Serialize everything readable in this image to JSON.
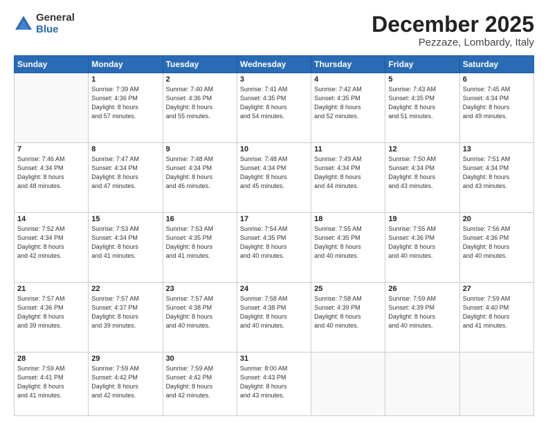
{
  "logo": {
    "general": "General",
    "blue": "Blue"
  },
  "header": {
    "month": "December 2025",
    "location": "Pezzaze, Lombardy, Italy"
  },
  "days_header": [
    "Sunday",
    "Monday",
    "Tuesday",
    "Wednesday",
    "Thursday",
    "Friday",
    "Saturday"
  ],
  "weeks": [
    [
      {
        "day": "",
        "info": ""
      },
      {
        "day": "1",
        "info": "Sunrise: 7:39 AM\nSunset: 4:36 PM\nDaylight: 8 hours\nand 57 minutes."
      },
      {
        "day": "2",
        "info": "Sunrise: 7:40 AM\nSunset: 4:36 PM\nDaylight: 8 hours\nand 55 minutes."
      },
      {
        "day": "3",
        "info": "Sunrise: 7:41 AM\nSunset: 4:35 PM\nDaylight: 8 hours\nand 54 minutes."
      },
      {
        "day": "4",
        "info": "Sunrise: 7:42 AM\nSunset: 4:35 PM\nDaylight: 8 hours\nand 52 minutes."
      },
      {
        "day": "5",
        "info": "Sunrise: 7:43 AM\nSunset: 4:35 PM\nDaylight: 8 hours\nand 51 minutes."
      },
      {
        "day": "6",
        "info": "Sunrise: 7:45 AM\nSunset: 4:34 PM\nDaylight: 8 hours\nand 49 minutes."
      }
    ],
    [
      {
        "day": "7",
        "info": "Sunrise: 7:46 AM\nSunset: 4:34 PM\nDaylight: 8 hours\nand 48 minutes."
      },
      {
        "day": "8",
        "info": "Sunrise: 7:47 AM\nSunset: 4:34 PM\nDaylight: 8 hours\nand 47 minutes."
      },
      {
        "day": "9",
        "info": "Sunrise: 7:48 AM\nSunset: 4:34 PM\nDaylight: 8 hours\nand 46 minutes."
      },
      {
        "day": "10",
        "info": "Sunrise: 7:48 AM\nSunset: 4:34 PM\nDaylight: 8 hours\nand 45 minutes."
      },
      {
        "day": "11",
        "info": "Sunrise: 7:49 AM\nSunset: 4:34 PM\nDaylight: 8 hours\nand 44 minutes."
      },
      {
        "day": "12",
        "info": "Sunrise: 7:50 AM\nSunset: 4:34 PM\nDaylight: 8 hours\nand 43 minutes."
      },
      {
        "day": "13",
        "info": "Sunrise: 7:51 AM\nSunset: 4:34 PM\nDaylight: 8 hours\nand 43 minutes."
      }
    ],
    [
      {
        "day": "14",
        "info": "Sunrise: 7:52 AM\nSunset: 4:34 PM\nDaylight: 8 hours\nand 42 minutes."
      },
      {
        "day": "15",
        "info": "Sunrise: 7:53 AM\nSunset: 4:34 PM\nDaylight: 8 hours\nand 41 minutes."
      },
      {
        "day": "16",
        "info": "Sunrise: 7:53 AM\nSunset: 4:35 PM\nDaylight: 8 hours\nand 41 minutes."
      },
      {
        "day": "17",
        "info": "Sunrise: 7:54 AM\nSunset: 4:35 PM\nDaylight: 8 hours\nand 40 minutes."
      },
      {
        "day": "18",
        "info": "Sunrise: 7:55 AM\nSunset: 4:35 PM\nDaylight: 8 hours\nand 40 minutes."
      },
      {
        "day": "19",
        "info": "Sunrise: 7:55 AM\nSunset: 4:36 PM\nDaylight: 8 hours\nand 40 minutes."
      },
      {
        "day": "20",
        "info": "Sunrise: 7:56 AM\nSunset: 4:36 PM\nDaylight: 8 hours\nand 40 minutes."
      }
    ],
    [
      {
        "day": "21",
        "info": "Sunrise: 7:57 AM\nSunset: 4:36 PM\nDaylight: 8 hours\nand 39 minutes."
      },
      {
        "day": "22",
        "info": "Sunrise: 7:57 AM\nSunset: 4:37 PM\nDaylight: 8 hours\nand 39 minutes."
      },
      {
        "day": "23",
        "info": "Sunrise: 7:57 AM\nSunset: 4:38 PM\nDaylight: 8 hours\nand 40 minutes."
      },
      {
        "day": "24",
        "info": "Sunrise: 7:58 AM\nSunset: 4:38 PM\nDaylight: 8 hours\nand 40 minutes."
      },
      {
        "day": "25",
        "info": "Sunrise: 7:58 AM\nSunset: 4:39 PM\nDaylight: 8 hours\nand 40 minutes."
      },
      {
        "day": "26",
        "info": "Sunrise: 7:59 AM\nSunset: 4:39 PM\nDaylight: 8 hours\nand 40 minutes."
      },
      {
        "day": "27",
        "info": "Sunrise: 7:59 AM\nSunset: 4:40 PM\nDaylight: 8 hours\nand 41 minutes."
      }
    ],
    [
      {
        "day": "28",
        "info": "Sunrise: 7:59 AM\nSunset: 4:41 PM\nDaylight: 8 hours\nand 41 minutes."
      },
      {
        "day": "29",
        "info": "Sunrise: 7:59 AM\nSunset: 4:42 PM\nDaylight: 8 hours\nand 42 minutes."
      },
      {
        "day": "30",
        "info": "Sunrise: 7:59 AM\nSunset: 4:42 PM\nDaylight: 8 hours\nand 42 minutes."
      },
      {
        "day": "31",
        "info": "Sunrise: 8:00 AM\nSunset: 4:43 PM\nDaylight: 8 hours\nand 43 minutes."
      },
      {
        "day": "",
        "info": ""
      },
      {
        "day": "",
        "info": ""
      },
      {
        "day": "",
        "info": ""
      }
    ]
  ]
}
